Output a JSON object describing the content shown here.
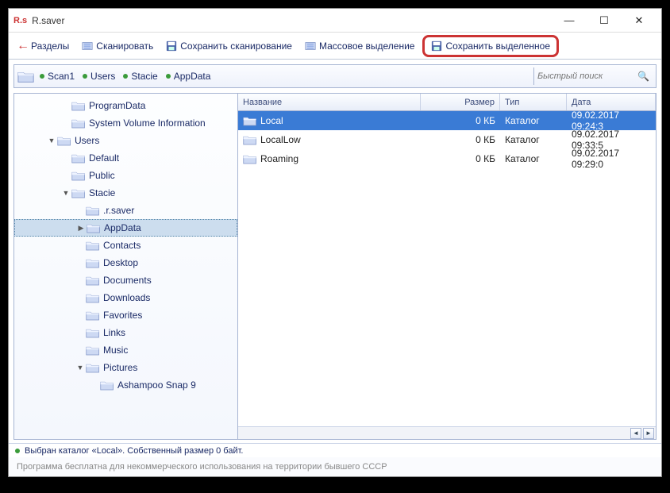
{
  "window": {
    "logo": "R.s",
    "title": "R.saver"
  },
  "toolbar": {
    "back_label": "Разделы",
    "scan_label": "Сканировать",
    "save_scan_label": "Сохранить сканирование",
    "mass_select_label": "Массовое выделение",
    "save_selected_label": "Сохранить выделенное"
  },
  "pathbar": {
    "segments": [
      "Scan1",
      "Users",
      "Stacie",
      "AppData"
    ],
    "search_placeholder": "Быстрый поиск"
  },
  "tree": [
    {
      "label": "ProgramData",
      "indent": 3,
      "arrow": ""
    },
    {
      "label": "System Volume Information",
      "indent": 3,
      "arrow": ""
    },
    {
      "label": "Users",
      "indent": 2,
      "arrow": "▼"
    },
    {
      "label": "Default",
      "indent": 3,
      "arrow": ""
    },
    {
      "label": "Public",
      "indent": 3,
      "arrow": ""
    },
    {
      "label": "Stacie",
      "indent": 3,
      "arrow": "▼"
    },
    {
      "label": ".r.saver",
      "indent": 4,
      "arrow": ""
    },
    {
      "label": "AppData",
      "indent": 4,
      "arrow": "▶",
      "selected": true
    },
    {
      "label": "Contacts",
      "indent": 4,
      "arrow": ""
    },
    {
      "label": "Desktop",
      "indent": 4,
      "arrow": ""
    },
    {
      "label": "Documents",
      "indent": 4,
      "arrow": ""
    },
    {
      "label": "Downloads",
      "indent": 4,
      "arrow": ""
    },
    {
      "label": "Favorites",
      "indent": 4,
      "arrow": ""
    },
    {
      "label": "Links",
      "indent": 4,
      "arrow": ""
    },
    {
      "label": "Music",
      "indent": 4,
      "arrow": ""
    },
    {
      "label": "Pictures",
      "indent": 4,
      "arrow": "▼"
    },
    {
      "label": "Ashampoo Snap 9",
      "indent": 5,
      "arrow": ""
    }
  ],
  "list": {
    "columns": {
      "name": "Название",
      "size": "Размер",
      "type": "Тип",
      "date": "Дата"
    },
    "rows": [
      {
        "name": "Local",
        "size": "0 КБ",
        "type": "Каталог",
        "date": "09.02.2017 09:24:3",
        "selected": true
      },
      {
        "name": "LocalLow",
        "size": "0 КБ",
        "type": "Каталог",
        "date": "09.02.2017 09:33:5"
      },
      {
        "name": "Roaming",
        "size": "0 КБ",
        "type": "Каталог",
        "date": "09.02.2017 09:29:0"
      }
    ]
  },
  "statusbar": "Выбран каталог «Local». Собственный размер 0 байт.",
  "footer": "Программа бесплатна для некоммерческого использования на территории бывшего СССР"
}
